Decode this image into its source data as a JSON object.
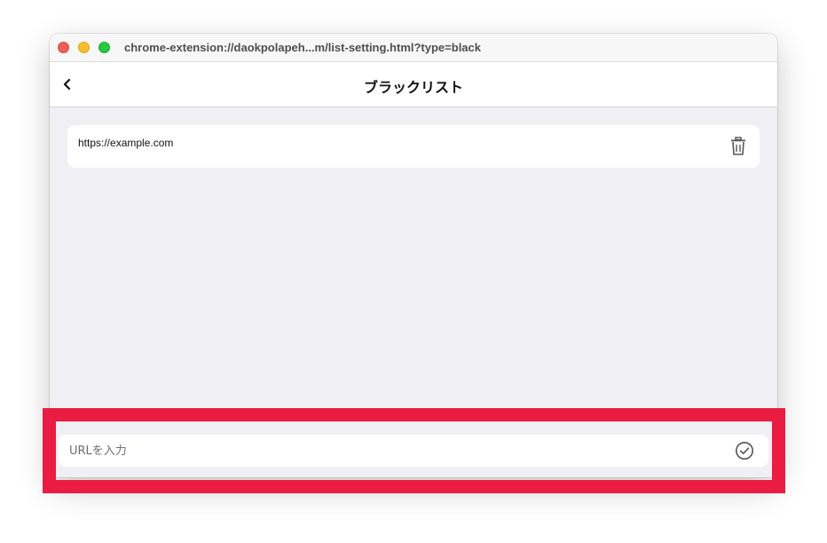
{
  "window": {
    "url": "chrome-extension://daokpolapeh...m/list-setting.html?type=black"
  },
  "header": {
    "title": "ブラックリスト",
    "back_icon": "chevron-left-icon"
  },
  "list": {
    "items": [
      {
        "url": "https://example.com",
        "action_icon": "trash-icon"
      }
    ]
  },
  "input": {
    "placeholder": "URLを入力",
    "value": "",
    "submit_icon": "check-circle-icon"
  },
  "colors": {
    "highlight": "#ea1c41",
    "background": "#efeff4",
    "card": "#ffffff"
  }
}
